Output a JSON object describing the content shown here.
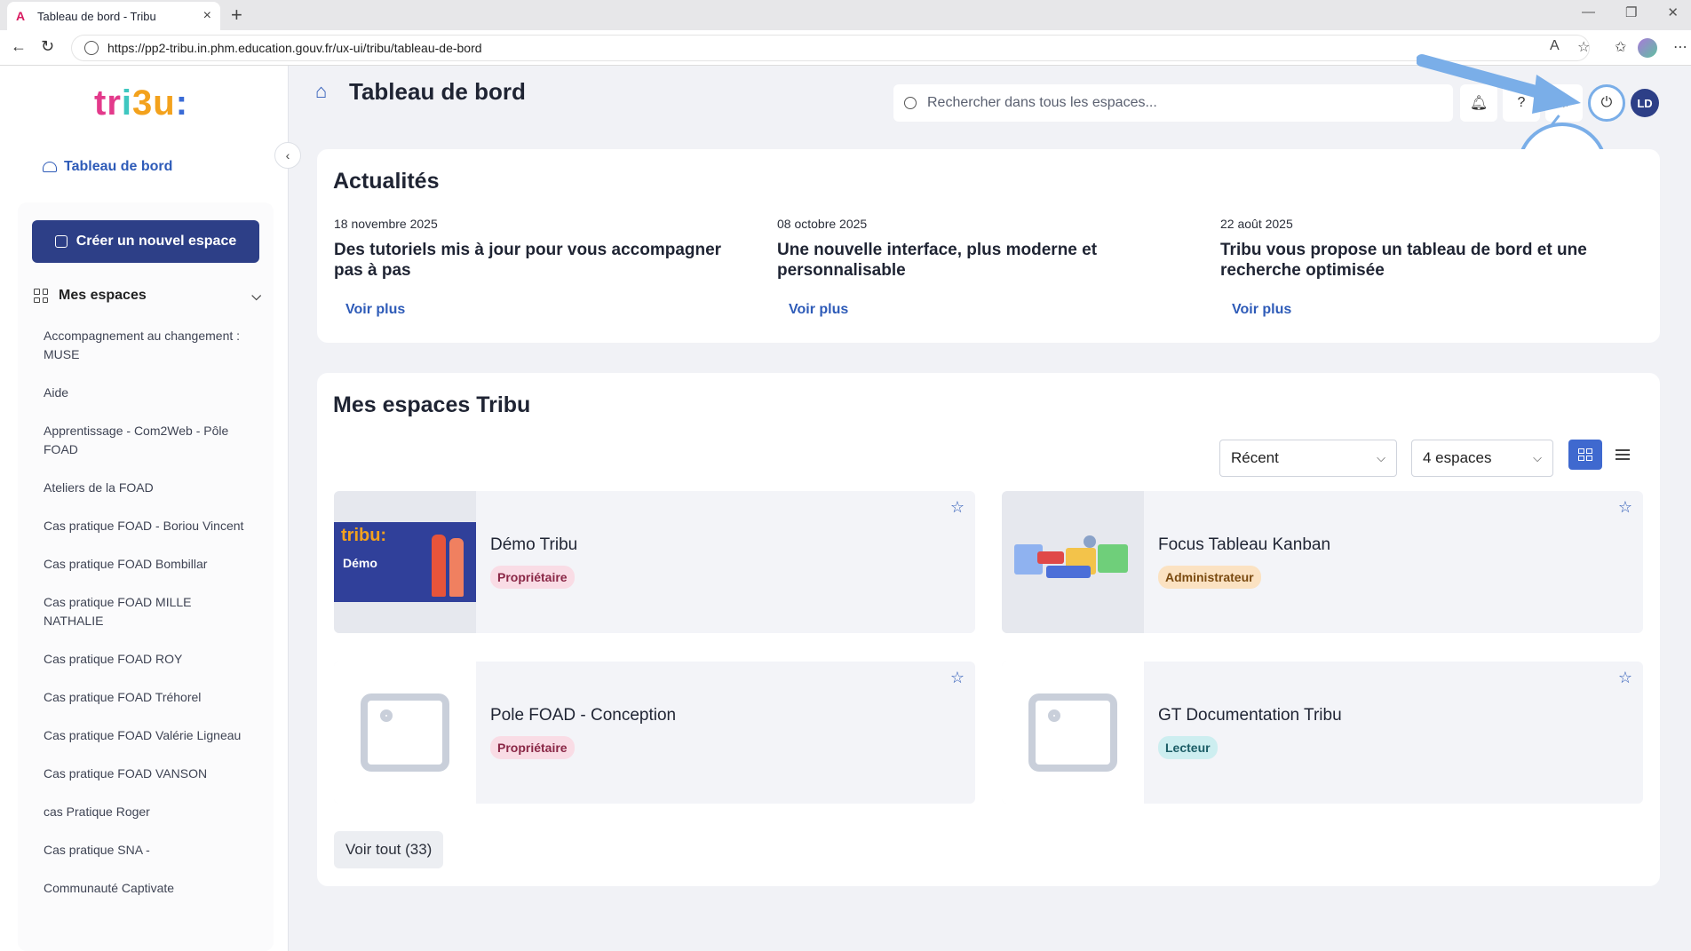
{
  "browser": {
    "tab_title": "Tableau de bord - Tribu",
    "url": "https://pp2-tribu.in.phm.education.gouv.fr/ux-ui/tribu/tableau-de-bord"
  },
  "sidebar": {
    "logo": {
      "t": "tr",
      "i": "i",
      "b": "3u",
      "colon": ":"
    },
    "dashboard_link": "Tableau de bord",
    "create_button": "Créer un nouvel espace",
    "my_spaces_label": "Mes espaces",
    "spaces": [
      "Accompagnement au changement : MUSE",
      "Aide",
      "Apprentissage - Com2Web - Pôle FOAD",
      "Ateliers de la FOAD",
      "Cas pratique FOAD - Boriou Vincent",
      "Cas pratique FOAD Bombillar",
      "Cas pratique FOAD MILLE NATHALIE",
      "Cas pratique FOAD ROY",
      "Cas pratique FOAD Tréhorel",
      "Cas pratique FOAD Valérie Ligneau",
      "Cas pratique FOAD VANSON",
      "cas Pratique Roger",
      "Cas pratique SNA -",
      "Communauté Captivate"
    ]
  },
  "header": {
    "title": "Tableau de bord",
    "search_placeholder": "Rechercher dans tous les espaces...",
    "avatar_initials": "LD"
  },
  "news": {
    "title": "Actualités",
    "items": [
      {
        "date": "18 novembre 2025",
        "headline": "Des tutoriels mis à jour pour vous accompagner pas à pas",
        "more": "Voir plus"
      },
      {
        "date": "08 octobre 2025",
        "headline": "Une nouvelle interface, plus moderne et personnalisable",
        "more": "Voir plus"
      },
      {
        "date": "22 août 2025",
        "headline": "Tribu vous propose un tableau de bord et une recherche optimisée",
        "more": "Voir plus"
      }
    ]
  },
  "my_spaces": {
    "title": "Mes espaces Tribu",
    "sort_value": "Récent",
    "count_value": "4 espaces",
    "cards": [
      {
        "name": "Démo Tribu",
        "role": "Propriétaire",
        "thumb_title": "tribu:",
        "thumb_sub": "Démo"
      },
      {
        "name": "Focus Tableau Kanban",
        "role": "Administrateur"
      },
      {
        "name": "Pole FOAD - Conception",
        "role": "Propriétaire"
      },
      {
        "name": "GT Documentation Tribu",
        "role": "Lecteur"
      }
    ],
    "see_all": "Voir tout (33)"
  },
  "colors": {
    "primary": "#2d3f87",
    "link": "#2e5bb8",
    "highlight": "#7aaee8"
  }
}
